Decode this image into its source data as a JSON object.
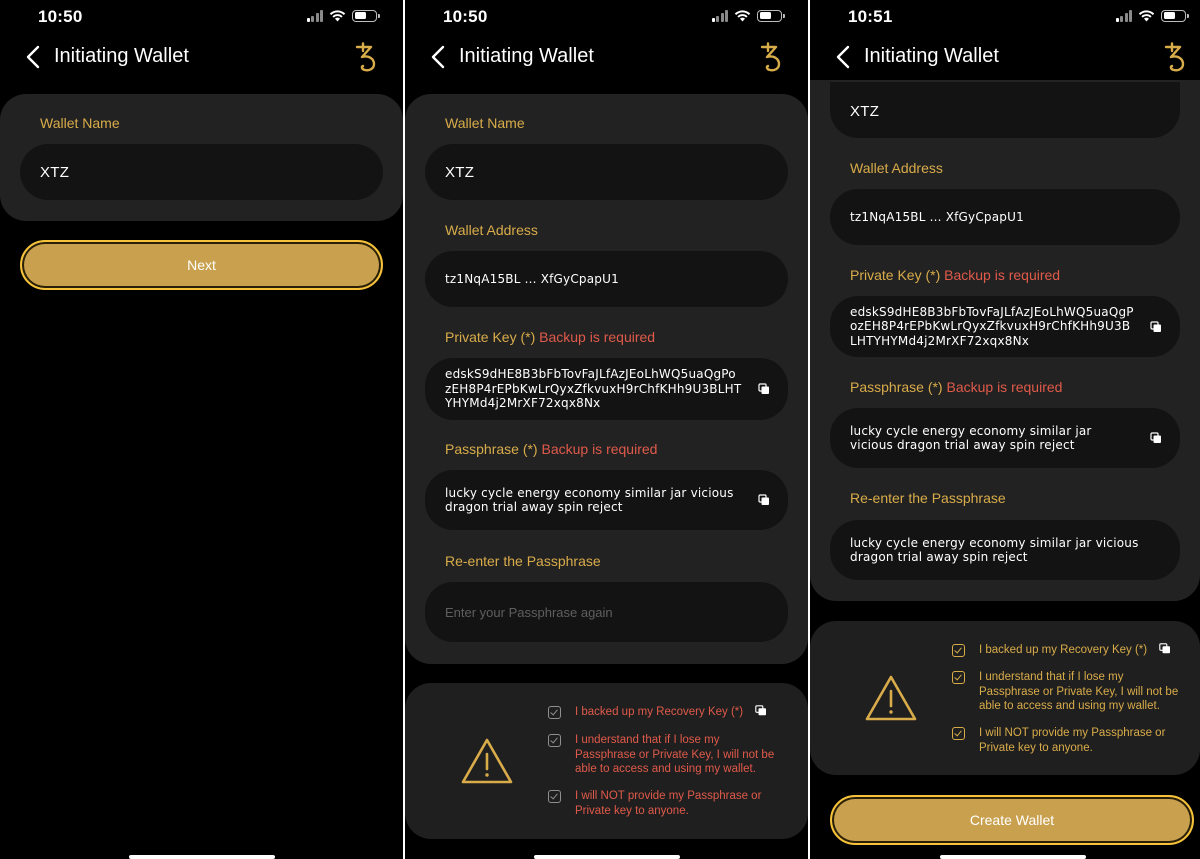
{
  "screens": [
    {
      "time": "10:50",
      "title": "Initiating Wallet",
      "wallet_name_label": "Wallet Name",
      "wallet_name_value": "XTZ",
      "next_button": "Next"
    },
    {
      "time": "10:50",
      "title": "Initiating Wallet",
      "wallet_name_label": "Wallet Name",
      "wallet_name_value": "XTZ",
      "wallet_address_label": "Wallet Address",
      "wallet_address_value": "tz1NqA15BL ... XfGyCpapU1",
      "private_key_label": "Private Key (*)",
      "private_key_req": " Backup is required",
      "private_key_value": "edskS9dHE8B3bFbTovFaJLfAzJEoLhWQ5uaQgPozEH8P4rEPbKwLrQyxZfkvuxH9rChfKHh9U3BLHTYHYMd4j2MrXF72xqx8Nx",
      "passphrase_label": "Passphrase (*)",
      "passphrase_req": " Backup is required",
      "passphrase_value": "lucky cycle energy economy similar jar vicious dragon trial away spin reject",
      "reenter_label": "Re-enter the Passphrase",
      "reenter_placeholder": "Enter your Passphrase again",
      "checks": [
        "I backed up my Recovery Key (*)",
        "I understand that if I lose my Passphrase or Private Key, I will not be able to access and using my wallet.",
        "I will NOT provide my Passphrase or Private key to anyone."
      ]
    },
    {
      "time": "10:51",
      "title": "Initiating Wallet",
      "wallet_name_value": "XTZ",
      "wallet_address_label": "Wallet Address",
      "wallet_address_value": "tz1NqA15BL ... XfGyCpapU1",
      "private_key_label": "Private Key (*)",
      "private_key_req": " Backup is required",
      "private_key_value": "edskS9dHE8B3bFbTovFaJLfAzJEoLhWQ5uaQgPozEH8P4rEPbKwLrQyxZfkvuxH9rChfKHh9U3BLHTYHYMd4j2MrXF72xqx8Nx",
      "passphrase_label": "Passphrase (*)",
      "passphrase_req": " Backup is required",
      "passphrase_value": "lucky cycle energy economy similar jar vicious dragon trial away spin reject",
      "reenter_label": "Re-enter the Passphrase",
      "reenter_value": "lucky cycle energy economy similar jar vicious dragon trial away spin reject",
      "checks": [
        "I backed up my Recovery Key (*)",
        "I understand that if I lose my Passphrase or Private Key, I will not be able to access and using my wallet.",
        "I will NOT provide my Passphrase or Private key to anyone."
      ],
      "create_button": "Create Wallet"
    }
  ],
  "icons": {
    "back": "chevron-left-icon",
    "tezos": "tezos-logo-icon",
    "copy": "copy-icon",
    "warning": "warning-triangle-icon",
    "check": "checkbox-check-icon"
  },
  "colors": {
    "background": "#000000",
    "panel": "#222222",
    "field": "#131313",
    "gold": "#d9ac4a",
    "button": "#c9a14e",
    "required": "#e05a4a"
  }
}
